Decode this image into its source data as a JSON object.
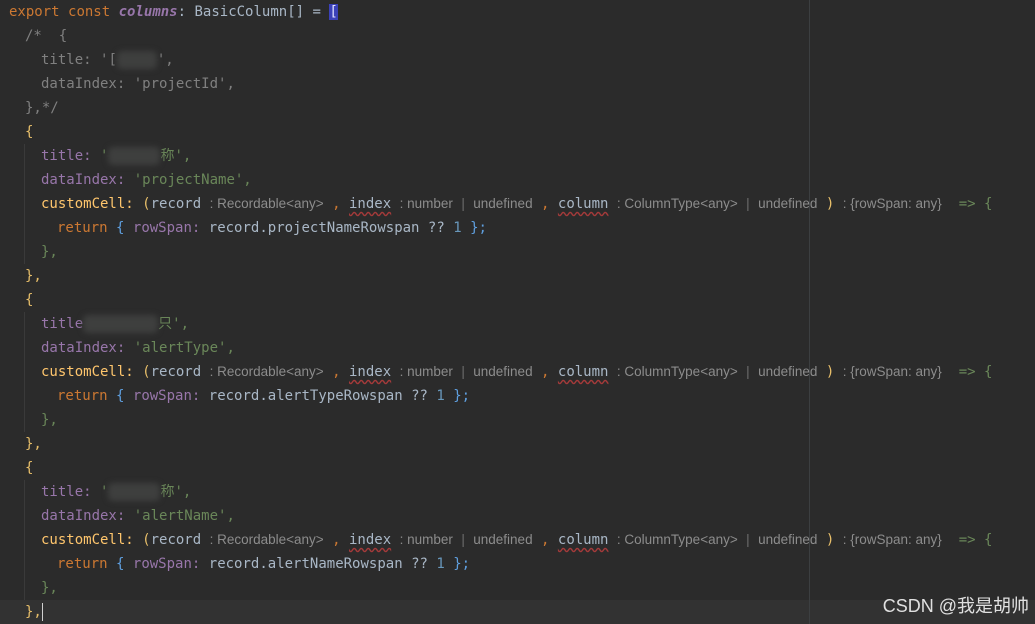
{
  "code": {
    "kw_export": "export",
    "kw_const": "const",
    "var_columns": "columns",
    "type_basic": "BasicColumn[]",
    "op_eq": "=",
    "open_bracket": "[",
    "comment_open": "/*  {",
    "comment_title_prop": "title:",
    "comment_title_val_a": "'[",
    "comment_title_val_b": "',",
    "comment_dataindex_prop": "dataIndex:",
    "comment_dataindex_val": "'projectId',",
    "comment_close": "},*/",
    "brace_open": "{",
    "title_prop": "title:",
    "col1_title_a": "'",
    "col1_title_b": "称',",
    "dataindex_prop": "dataIndex:",
    "col1_dataindex": "'projectName',",
    "customcell": "customCell:",
    "paren_open": "(",
    "record": "record",
    "record_type": ": Recordable<any>",
    "comma": ",",
    "index": "index",
    "index_type": ": number",
    "sep": "|",
    "undefined": "undefined",
    "column": "column",
    "column_type": ": ColumnType<any>",
    "paren_close": ")",
    "return_type": ": {rowSpan: any}",
    "arrow": "=> {",
    "kw_return": "return",
    "rowspan_prop": "rowSpan:",
    "col1_rowspan_expr": "record.projectNameRowspan",
    "nullish": "??",
    "num_one": "1",
    "inner_close": "};",
    "fn_close": "},",
    "obj_close": "},",
    "col2_title_a": "title",
    "col2_title_b": "只',",
    "col2_dataindex": "'alertType',",
    "col2_rowspan_expr": "record.alertTypeRowspan",
    "col3_title_a": "'",
    "col3_title_b": "称',",
    "col3_dataindex": "'alertName',",
    "col3_rowspan_expr": "record.alertNameRowspan",
    "last_close": "},"
  },
  "watermark": "CSDN @我是胡帅",
  "colors": {
    "background": "#2b2b2b",
    "keyword": "#cc7832",
    "string": "#6a8759",
    "property": "#9876aa",
    "number": "#6897bb"
  }
}
